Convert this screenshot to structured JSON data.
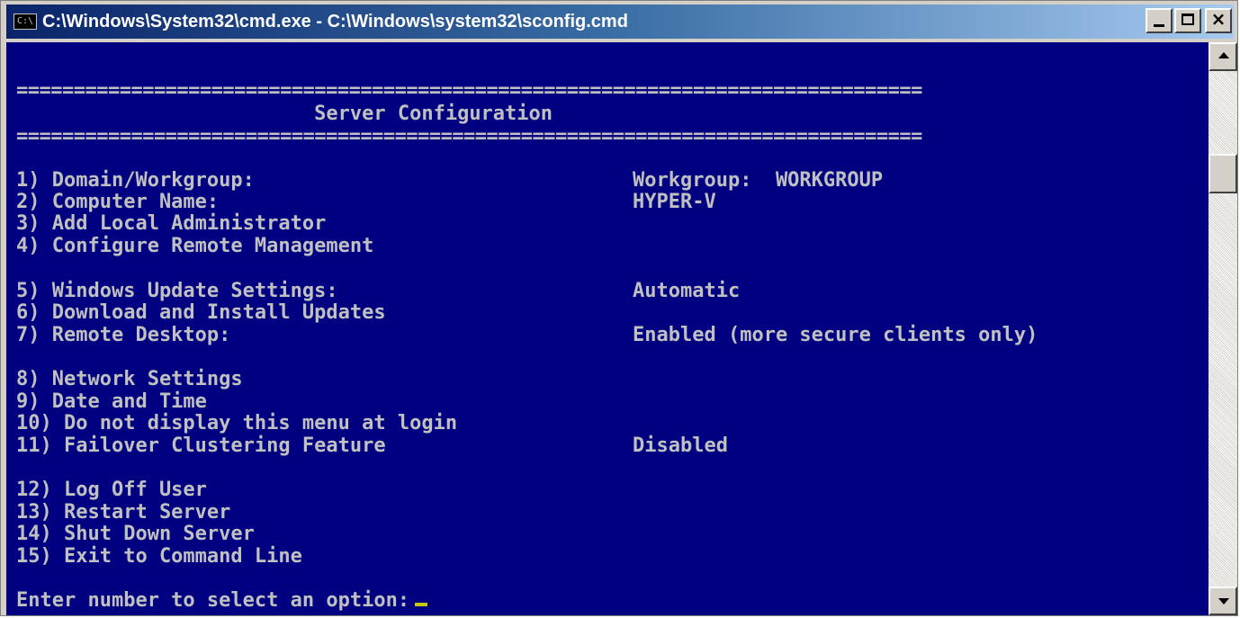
{
  "window": {
    "title": "C:\\Windows\\System32\\cmd.exe - C:\\Windows\\system32\\sconfig.cmd",
    "icon_text": "C:\\",
    "buttons": {
      "minimize": "minimize-icon",
      "maximize": "maximize-icon",
      "close": "×"
    }
  },
  "colors": {
    "console_bg": "#000080",
    "console_fg": "#c0c0c0",
    "cursor": "#c8c800"
  },
  "console": {
    "separator": "===============================================================================",
    "header": "                         Server Configuration",
    "menu": [
      {
        "label": "1) Domain/Workgroup:",
        "value": "Workgroup:  WORKGROUP"
      },
      {
        "label": "2) Computer Name:",
        "value": "HYPER-V"
      },
      {
        "label": "3) Add Local Administrator",
        "value": ""
      },
      {
        "label": "4) Configure Remote Management",
        "value": ""
      },
      {
        "label": "5) Windows Update Settings:",
        "value": "Automatic"
      },
      {
        "label": "6) Download and Install Updates",
        "value": ""
      },
      {
        "label": "7) Remote Desktop:",
        "value": "Enabled (more secure clients only)"
      },
      {
        "label": "8) Network Settings",
        "value": ""
      },
      {
        "label": "9) Date and Time",
        "value": ""
      },
      {
        "label": "10) Do not display this menu at login",
        "value": ""
      },
      {
        "label": "11) Failover Clustering Feature",
        "value": "Disabled"
      },
      {
        "label": "12) Log Off User",
        "value": ""
      },
      {
        "label": "13) Restart Server",
        "value": ""
      },
      {
        "label": "14) Shut Down Server",
        "value": ""
      },
      {
        "label": "15) Exit to Command Line",
        "value": ""
      }
    ],
    "prompt": "Enter number to select an option:"
  },
  "scrollbar": {
    "up_icon": "arrow-up-icon",
    "down_icon": "arrow-down-icon"
  }
}
